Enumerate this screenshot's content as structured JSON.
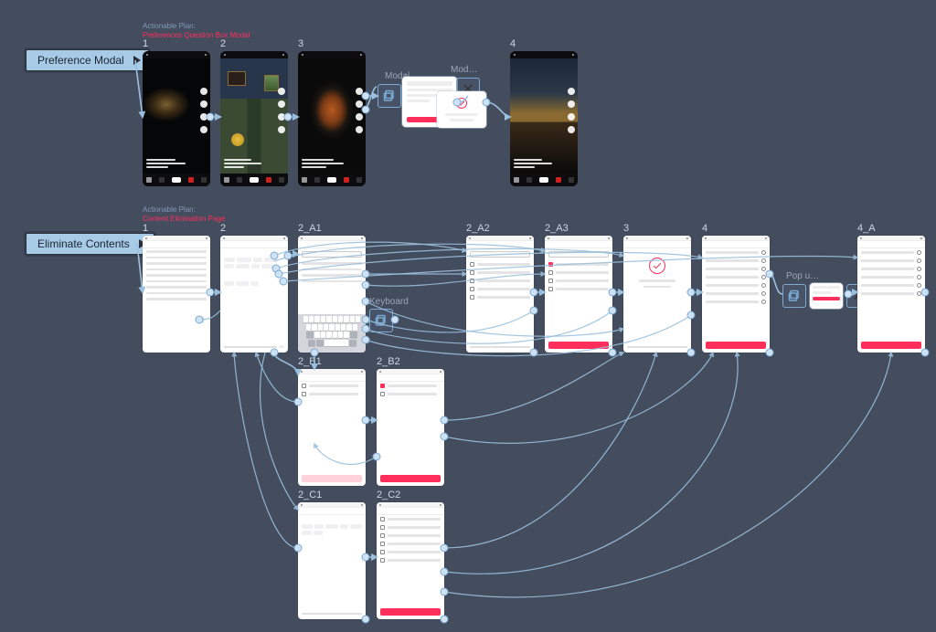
{
  "flows": {
    "preference": {
      "pill": "Preference Modal",
      "headline_top": "Actionable Plan:",
      "headline_accent": "Preferences Question Box Modal",
      "frames": [
        "1",
        "2",
        "3",
        "4"
      ],
      "modal_label": "Modal",
      "modal_label_trunc": "Mod…"
    },
    "eliminate": {
      "pill": "Eliminate Contents",
      "headline_top": "Actionable Plan:",
      "headline_accent": "Content Elimination Page",
      "frames": [
        "1",
        "2",
        "2_A1",
        "2_A2",
        "2_A3",
        "3",
        "4",
        "4_A",
        "2_B1",
        "2_B2",
        "2_C1",
        "2_C2"
      ],
      "keyboard_label": "Keyboard",
      "popup_label": "Pop u…"
    }
  },
  "labels": {
    "close": "✕"
  }
}
